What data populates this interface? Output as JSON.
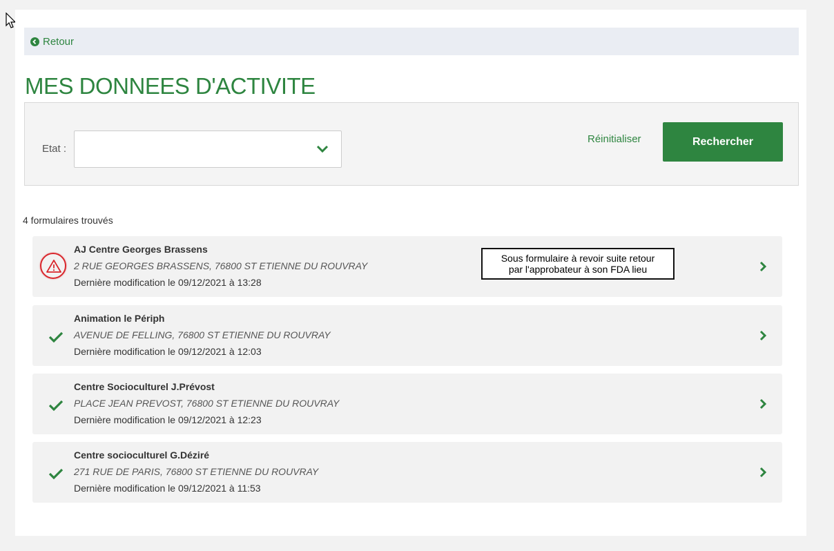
{
  "back": {
    "label": "Retour"
  },
  "page_title": "MES DONNEES D'ACTIVITE",
  "filter": {
    "etat_label": "Etat :",
    "etat_value": "",
    "reset_label": "Réinitialiser",
    "search_label": "Rechercher"
  },
  "results_count": "4 formulaires trouvés",
  "forms": [
    {
      "name": "AJ Centre Georges Brassens",
      "address": "2 RUE GEORGES BRASSENS, 76800 ST ETIENNE DU ROUVRAY",
      "modified": "Dernière modification le 09/12/2021 à 13:28",
      "status_icon": "warning-icon",
      "note_line1": "Sous formulaire à revoir suite retour",
      "note_line2": "par l'approbateur à son FDA lieu"
    },
    {
      "name": "Animation le Périph",
      "address": "AVENUE DE FELLING, 76800 ST ETIENNE DU ROUVRAY",
      "modified": "Dernière modification le 09/12/2021 à 12:03",
      "status_icon": "check-icon"
    },
    {
      "name": "Centre Socioculturel J.Prévost",
      "address": "PLACE JEAN PREVOST, 76800 ST ETIENNE DU ROUVRAY",
      "modified": "Dernière modification le 09/12/2021 à 12:23",
      "status_icon": "check-icon"
    },
    {
      "name": "Centre socioculturel G.Déziré",
      "address": "271 RUE DE PARIS, 76800 ST ETIENNE DU ROUVRAY",
      "modified": "Dernière modification le 09/12/2021 à 11:53",
      "status_icon": "check-icon"
    }
  ],
  "colors": {
    "accent": "#2e8540",
    "warning": "#d9262c",
    "card_bg": "#f2f2f2"
  }
}
